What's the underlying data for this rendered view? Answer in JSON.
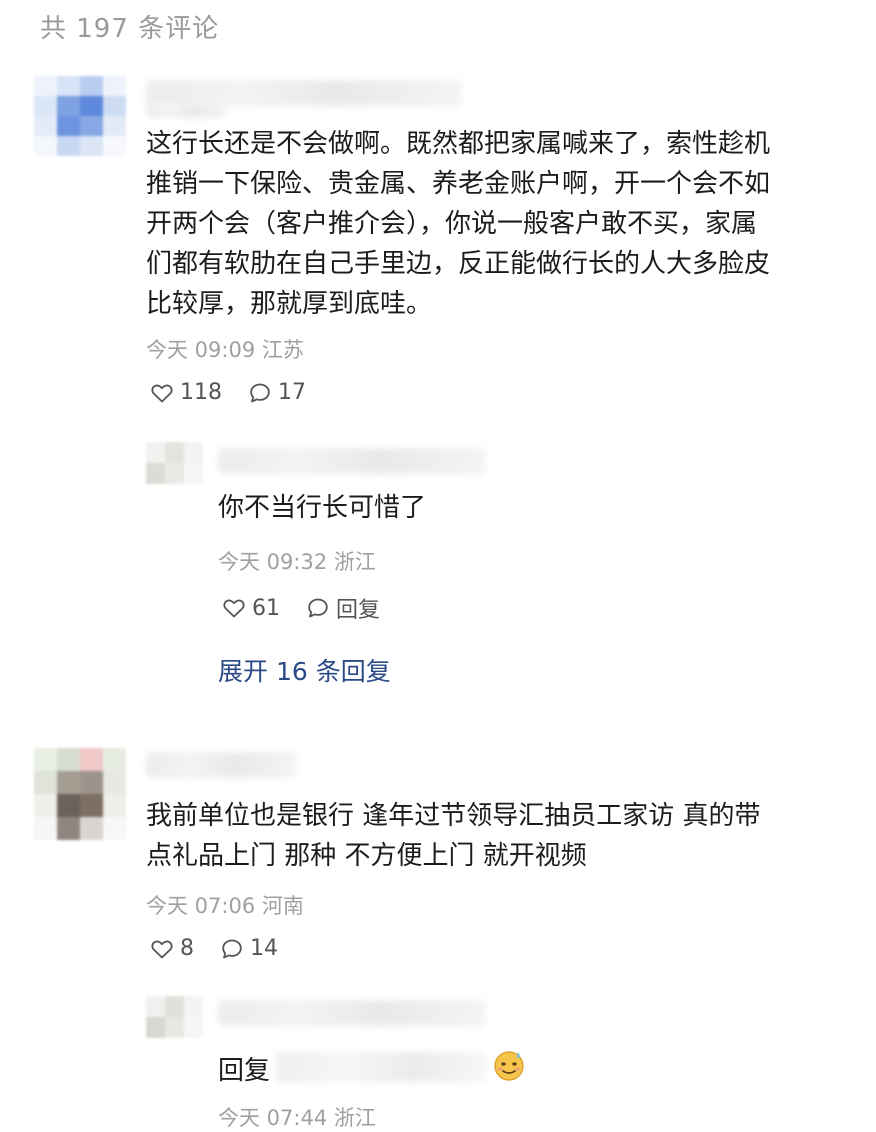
{
  "header": {
    "count_text": "共 197 条评论"
  },
  "comments": [
    {
      "text_lines": [
        "这行长还是不会做啊。既然都把家属喊来了，索性趁机",
        "推销一下保险、贵金属、养老金账户啊，开一个会不如",
        "开两个会（客户推介会），你说一般客户敢不买，家属",
        "们都有软肋在自己手里边，反正能做行长的人大多脸皮",
        "比较厚，那就厚到底哇。"
      ],
      "meta": "今天 09:09 江苏",
      "likes": "118",
      "replies": "17",
      "sub_reply": {
        "text": "你不当行长可惜了",
        "meta": "今天 09:32 浙江",
        "likes": "61",
        "reply_label": "回复"
      },
      "expand_text": "展开 16 条回复"
    },
    {
      "text_lines": [
        "我前单位也是银行 逢年过节领导汇抽员工家访 真的带",
        "点礼品上门 那种 不方便上门 就开视频"
      ],
      "meta": "今天 07:06 河南",
      "likes": "8",
      "replies": "14",
      "sub_reply": {
        "prefix": "回复",
        "emoji": "sweat-smile-emoji",
        "meta": "今天 07:44 浙江"
      }
    }
  ],
  "icons": {
    "like": "heart-outline-icon",
    "comment": "speech-bubble-icon"
  },
  "colors": {
    "link": "#2b4a87",
    "meta": "#a0a0a0"
  }
}
